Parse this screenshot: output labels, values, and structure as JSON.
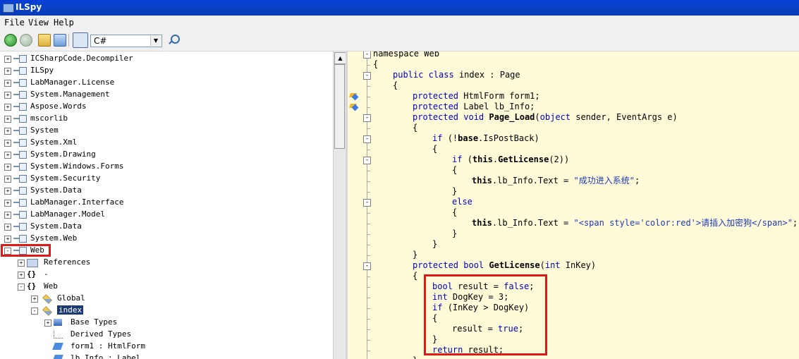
{
  "window": {
    "title": "ILSpy"
  },
  "menu": [
    "File",
    "View",
    "Help"
  ],
  "toolbar": {
    "language": "C#"
  },
  "tree": [
    {
      "label": "ICSharpCode.Decompiler",
      "indent": 0,
      "icon": "assembly-icon",
      "exp": "+"
    },
    {
      "label": "ILSpy",
      "indent": 0,
      "icon": "assembly-icon",
      "exp": "+"
    },
    {
      "label": "LabManager.License",
      "indent": 0,
      "icon": "assembly-icon",
      "exp": "+"
    },
    {
      "label": "System.Management",
      "indent": 0,
      "icon": "assembly-icon",
      "exp": "+"
    },
    {
      "label": "Aspose.Words",
      "indent": 0,
      "icon": "assembly-icon",
      "exp": "+"
    },
    {
      "label": "mscorlib",
      "indent": 0,
      "icon": "assembly-icon",
      "exp": "+"
    },
    {
      "label": "System",
      "indent": 0,
      "icon": "assembly-icon",
      "exp": "+"
    },
    {
      "label": "System.Xml",
      "indent": 0,
      "icon": "assembly-icon",
      "exp": "+"
    },
    {
      "label": "System.Drawing",
      "indent": 0,
      "icon": "assembly-icon",
      "exp": "+"
    },
    {
      "label": "System.Windows.Forms",
      "indent": 0,
      "icon": "assembly-icon",
      "exp": "+"
    },
    {
      "label": "System.Security",
      "indent": 0,
      "icon": "assembly-icon",
      "exp": "+"
    },
    {
      "label": "System.Data",
      "indent": 0,
      "icon": "assembly-icon",
      "exp": "+"
    },
    {
      "label": "LabManager.Interface",
      "indent": 0,
      "icon": "assembly-icon",
      "exp": "+"
    },
    {
      "label": "LabManager.Model",
      "indent": 0,
      "icon": "assembly-icon",
      "exp": "+"
    },
    {
      "label": "System.Data",
      "indent": 0,
      "icon": "assembly-icon",
      "exp": "+"
    },
    {
      "label": "System.Web",
      "indent": 0,
      "icon": "assembly-icon",
      "exp": "+"
    },
    {
      "label": "Web",
      "indent": 0,
      "icon": "assembly-icon",
      "exp": "-"
    },
    {
      "label": "References",
      "indent": 1,
      "icon": "references-icon",
      "exp": "+"
    },
    {
      "label": "-",
      "indent": 1,
      "icon": "namespace-icon",
      "exp": "+"
    },
    {
      "label": "Web",
      "indent": 1,
      "icon": "namespace-icon",
      "exp": "-"
    },
    {
      "label": "Global",
      "indent": 2,
      "icon": "class-icon",
      "exp": "+"
    },
    {
      "label": "index",
      "indent": 2,
      "icon": "class-icon",
      "exp": "-",
      "selected": true
    },
    {
      "label": "Base Types",
      "indent": 3,
      "icon": "base-types-icon",
      "exp": "+"
    },
    {
      "label": "Derived Types",
      "indent": 3,
      "icon": "derived-types-icon",
      "exp": ""
    },
    {
      "label": "form1 : HtmlForm",
      "indent": 3,
      "icon": "field-icon",
      "exp": ""
    },
    {
      "label": "lb_Info : Label",
      "indent": 3,
      "icon": "field-icon",
      "exp": ""
    }
  ],
  "code": [
    {
      "i": 0,
      "segs": [
        {
          "t": "namespace Web"
        }
      ],
      "fold": "-"
    },
    {
      "i": 0,
      "segs": [
        {
          "t": "{"
        }
      ]
    },
    {
      "i": 1,
      "segs": [
        {
          "t": "public ",
          "c": "kw"
        },
        {
          "t": "class ",
          "c": "kw"
        },
        {
          "t": "index : Page"
        }
      ],
      "fold": "-"
    },
    {
      "i": 1,
      "segs": [
        {
          "t": "{"
        }
      ]
    },
    {
      "i": 2,
      "segs": [
        {
          "t": "protected ",
          "c": "kw"
        },
        {
          "t": "HtmlForm form1;"
        }
      ],
      "bm": true
    },
    {
      "i": 2,
      "segs": [
        {
          "t": "protected ",
          "c": "kw"
        },
        {
          "t": "Label lb_Info;"
        }
      ],
      "bm": true
    },
    {
      "i": 2,
      "segs": [
        {
          "t": "protected ",
          "c": "kw"
        },
        {
          "t": "void ",
          "c": "kw"
        },
        {
          "t": "Page_Load",
          "c": "bold"
        },
        {
          "t": "("
        },
        {
          "t": "object ",
          "c": "kw"
        },
        {
          "t": "sender, EventArgs e)"
        }
      ],
      "fold": "-"
    },
    {
      "i": 2,
      "segs": [
        {
          "t": "{"
        }
      ]
    },
    {
      "i": 3,
      "segs": [
        {
          "t": "if ",
          "c": "kw"
        },
        {
          "t": "(!"
        },
        {
          "t": "base",
          "c": "bold"
        },
        {
          "t": ".IsPostBack)"
        }
      ],
      "fold": "-"
    },
    {
      "i": 3,
      "segs": [
        {
          "t": "{"
        }
      ]
    },
    {
      "i": 4,
      "segs": [
        {
          "t": "if ",
          "c": "kw"
        },
        {
          "t": "("
        },
        {
          "t": "this",
          "c": "bold"
        },
        {
          "t": "."
        },
        {
          "t": "GetLicense",
          "c": "bold"
        },
        {
          "t": "(2))"
        }
      ],
      "fold": "-"
    },
    {
      "i": 4,
      "segs": [
        {
          "t": "{"
        }
      ]
    },
    {
      "i": 5,
      "segs": [
        {
          "t": "this",
          "c": "bold"
        },
        {
          "t": ".lb_Info.Text = "
        },
        {
          "t": "\"成功进入系统\"",
          "c": "str"
        },
        {
          "t": ";"
        }
      ]
    },
    {
      "i": 4,
      "segs": [
        {
          "t": "}"
        }
      ]
    },
    {
      "i": 4,
      "segs": [
        {
          "t": "else",
          "c": "kw"
        }
      ],
      "fold": "-"
    },
    {
      "i": 4,
      "segs": [
        {
          "t": "{"
        }
      ]
    },
    {
      "i": 5,
      "segs": [
        {
          "t": "this",
          "c": "bold"
        },
        {
          "t": ".lb_Info.Text = "
        },
        {
          "t": "\"<span style='color:red'>请插入加密狗</span>\"",
          "c": "str"
        },
        {
          "t": ";"
        }
      ]
    },
    {
      "i": 4,
      "segs": [
        {
          "t": "}"
        }
      ]
    },
    {
      "i": 3,
      "segs": [
        {
          "t": "}"
        }
      ]
    },
    {
      "i": 2,
      "segs": [
        {
          "t": "}"
        }
      ]
    },
    {
      "i": 2,
      "segs": [
        {
          "t": "protected ",
          "c": "kw"
        },
        {
          "t": "bool ",
          "c": "kw"
        },
        {
          "t": "GetLicense",
          "c": "bold"
        },
        {
          "t": "("
        },
        {
          "t": "int ",
          "c": "kw"
        },
        {
          "t": "InKey)"
        }
      ],
      "fold": "-"
    },
    {
      "i": 2,
      "segs": [
        {
          "t": "{"
        }
      ]
    },
    {
      "i": 3,
      "segs": [
        {
          "t": "bool ",
          "c": "kw"
        },
        {
          "t": "result = "
        },
        {
          "t": "false",
          "c": "kw"
        },
        {
          "t": ";"
        }
      ]
    },
    {
      "i": 3,
      "segs": [
        {
          "t": "int ",
          "c": "kw"
        },
        {
          "t": "DogKey = 3;"
        }
      ]
    },
    {
      "i": 3,
      "segs": [
        {
          "t": "if ",
          "c": "kw"
        },
        {
          "t": "(InKey > DogKey)"
        }
      ]
    },
    {
      "i": 3,
      "segs": [
        {
          "t": "{"
        }
      ]
    },
    {
      "i": 4,
      "segs": [
        {
          "t": "result = "
        },
        {
          "t": "true",
          "c": "kw"
        },
        {
          "t": ";"
        }
      ]
    },
    {
      "i": 3,
      "segs": [
        {
          "t": "}"
        }
      ]
    },
    {
      "i": 3,
      "segs": [
        {
          "t": "return ",
          "c": "kw"
        },
        {
          "t": "result;"
        }
      ]
    },
    {
      "i": 2,
      "segs": [
        {
          "t": "}"
        }
      ]
    }
  ]
}
